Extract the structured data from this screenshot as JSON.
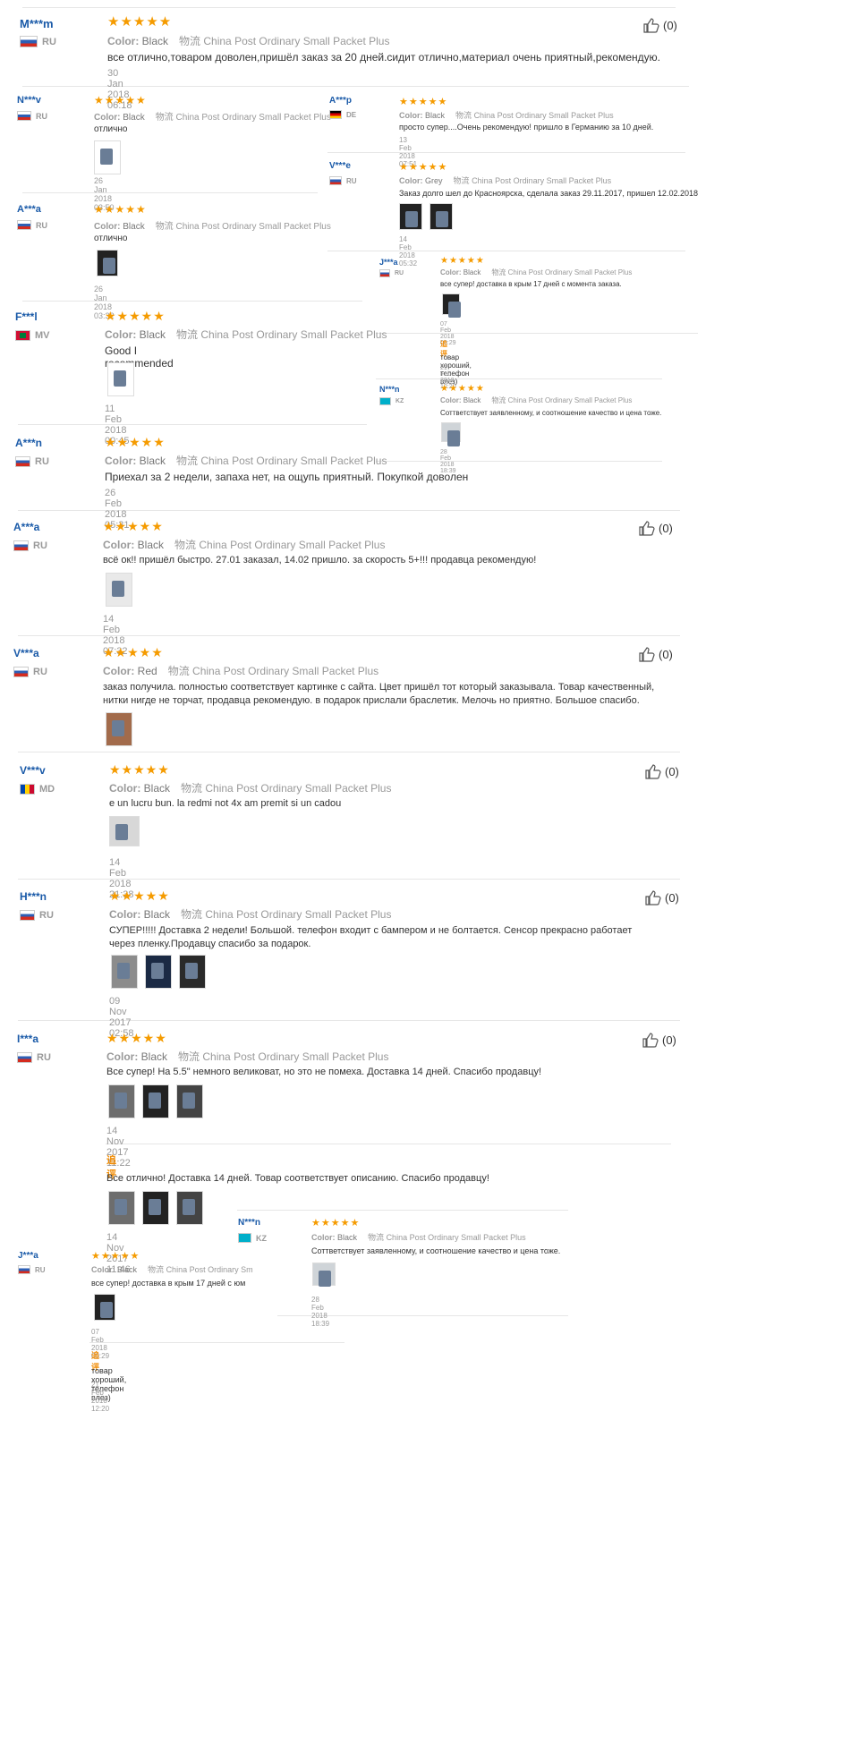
{
  "colors": {
    "username": "#1a5aa8",
    "stars": "#f59b00",
    "followup": "#f08a00"
  },
  "labels": {
    "color": "Color:",
    "shipping_prefix": "物流",
    "followup": "追评",
    "stars": "★★★★★"
  },
  "reviews": [
    {
      "user": "M***m",
      "country": "RU",
      "color": "Black",
      "shipping": "China Post Ordinary Small Packet Plus",
      "text": "все отлично,товаром доволен,пришёл заказ за 20 дней.сидит отлично,материал очень приятный,рекомендую.",
      "date": "30 Jan 2018 06:18",
      "likes": "(0)"
    },
    {
      "user": "N***v",
      "country": "RU",
      "color": "Black",
      "shipping": "China Post Ordinary Small Packet Plus",
      "text": "отлично",
      "date": "26 Jan 2018 03:50"
    },
    {
      "user": "A***p",
      "country": "DE",
      "color": "Black",
      "shipping": "China Post Ordinary Small Packet Plus",
      "text": "просто супер....Очень рекомендую! пришло в Германию за 10 дней.",
      "date": "13 Feb 2018 07:51"
    },
    {
      "user": "V***e",
      "country": "RU",
      "color": "Grey",
      "shipping": "China Post Ordinary Small Packet Plus",
      "text": "Заказ долго шел до Красноярска, сделала заказ 29.11.2017, пришел 12.02.2018",
      "date": "14 Feb 2018 05:32"
    },
    {
      "user": "A***a",
      "country": "RU",
      "color": "Black",
      "shipping": "China Post Ordinary Small Packet Plus",
      "text": "отлично",
      "date": "26 Jan 2018 03:32"
    },
    {
      "user": "J***a",
      "country": "RU",
      "color": "Black",
      "shipping": "China Post Ordinary Small Packet Plus",
      "text": "все супер! доставка в крым 17 дней с момента заказа.",
      "date": "07 Feb 2018 00:29",
      "followup_text": "товар хороший, телефон влез)",
      "followup_date": "21 Feb 2018 12:20"
    },
    {
      "user": "F***l",
      "country": "MV",
      "color": "Black",
      "shipping": "China Post Ordinary Small Packet Plus",
      "text": "Good I recommended",
      "date": "11 Feb 2018 00:45"
    },
    {
      "user": "N***n",
      "country": "KZ",
      "color": "Black",
      "shipping": "China Post Ordinary Small Packet Plus",
      "text": "Соттветствует заявленному, и соотношение качество и цена тоже.",
      "date": "28 Feb 2018 18:39"
    },
    {
      "user": "A***n",
      "country": "RU",
      "color": "Black",
      "shipping": "China Post Ordinary Small Packet Plus",
      "text": "Приехал за 2 недели, запаха нет, на ощупь приятный. Покупкой доволен",
      "date": "26 Feb 2018 05:31"
    },
    {
      "user": "A***a",
      "country": "RU",
      "color": "Black",
      "shipping": "China Post Ordinary Small Packet Plus",
      "text": "всё ок!! пришёл быстро. 27.01 заказал, 14.02 пришло. за скорость 5+!!! продавца рекомендую!",
      "date": "14 Feb 2018 07:32",
      "likes": "(0)"
    },
    {
      "user": "V***a",
      "country": "RU",
      "color": "Red",
      "shipping": "China Post Ordinary Small Packet Plus",
      "text": "заказ получила. полностью соответствует картинке с сайта. Цвет пришёл тот который заказывала. Товар качественный, нитки нигде не торчат, продавца рекомендую. в подарок прислали браслетик. Мелочь но приятно. Большое спасибо.",
      "date": "",
      "likes": "(0)"
    },
    {
      "user": "V***v",
      "country": "MD",
      "color": "Black",
      "shipping": "China Post Ordinary Small Packet Plus",
      "text": "e un lucru bun. la redmi not 4x am premit si un cadou",
      "date": "14 Feb 2018 21:38",
      "likes": "(0)"
    },
    {
      "user": "H***n",
      "country": "RU",
      "color": "Black",
      "shipping": "China Post Ordinary Small Packet Plus",
      "text": "СУПЕР!!!!! Доставка 2 недели! Большой. телефон входит с бампером и не болтается. Сенсор прекрасно работает через пленку.Продавцу спасибо за подарок.",
      "date": "09 Nov 2017 02:58",
      "likes": "(0)"
    },
    {
      "user": "I***a",
      "country": "RU",
      "color": "Black",
      "shipping": "China Post Ordinary Small Packet Plus",
      "text": "Все супер! На 5.5\" немного великоват, но это не помеха. Доставка 14 дней. Спасибо продавцу!",
      "date": "14 Nov 2017 11:22",
      "likes": "(0)",
      "followup_text": "Все отлично! Доставка 14 дней. Товар соответствует описанию. Спасибо продавцу!",
      "followup_date": "14 Nov 2017 11:46"
    },
    {
      "user": "N***n",
      "country": "KZ",
      "color": "Black",
      "shipping": "China Post Ordinary Small Packet Plus",
      "text": "Соттветствует заявленному, и соотношение качество и цена тоже.",
      "date": "28 Feb 2018 18:39"
    },
    {
      "user": "J***a",
      "country": "RU",
      "color": "Black",
      "shipping": "China Post Ordinary Sm",
      "text": "все супер! доставка в крым 17 дней с  юм",
      "date": "07 Feb 2018 00:29",
      "followup_text": "товар хороший, телефон влез)",
      "followup_date": "21 Feb 2018 12:20"
    }
  ]
}
